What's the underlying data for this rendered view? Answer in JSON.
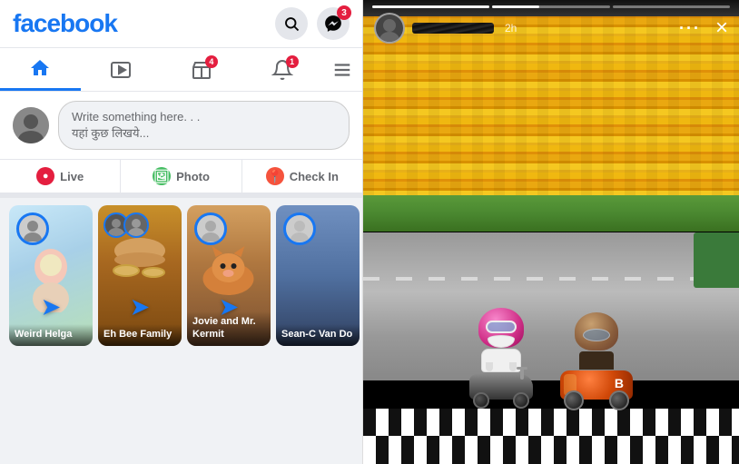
{
  "app": {
    "name": "facebook",
    "logo_color": "#1877f2"
  },
  "header": {
    "search_label": "Search",
    "messenger_label": "Messenger",
    "messenger_badge": "3"
  },
  "nav": {
    "tabs": [
      {
        "id": "home",
        "label": "Home",
        "icon": "🏠",
        "active": true,
        "badge": null
      },
      {
        "id": "watch",
        "label": "Watch",
        "icon": "▶",
        "active": false,
        "badge": null
      },
      {
        "id": "marketplace",
        "label": "Marketplace",
        "icon": "🛒",
        "active": false,
        "badge": "4"
      },
      {
        "id": "notifications",
        "label": "Notifications",
        "icon": "🔔",
        "active": false,
        "badge": "1"
      }
    ],
    "menu_icon": "☰"
  },
  "post_box": {
    "placeholder_line1": "Write something here. . .",
    "placeholder_line2": "यहां कुछ लिखये..."
  },
  "action_buttons": [
    {
      "id": "live",
      "label": "Live",
      "icon": "●"
    },
    {
      "id": "photo",
      "label": "Photo",
      "icon": "🖼"
    },
    {
      "id": "checkin",
      "label": "Check In",
      "icon": "📍"
    }
  ],
  "stories": [
    {
      "id": 1,
      "label": "Weird Helga",
      "bg": "story1",
      "has_arrow": true
    },
    {
      "id": 2,
      "label": "Eh Bee Family",
      "bg": "story2",
      "has_arrow": true
    },
    {
      "id": 3,
      "label": "Jovie and Mr. Kermit",
      "bg": "story3",
      "has_arrow": true
    },
    {
      "id": 4,
      "label": "Sean-C Van Do",
      "bg": "story4",
      "has_arrow": false
    }
  ],
  "right_story": {
    "username_hidden": true,
    "time": "2h",
    "progress_bars": [
      1,
      2,
      3
    ],
    "progress_fill_percent": 40,
    "scene": "go_kart_race",
    "characters": [
      {
        "id": "left",
        "helmet": "pink_with_goggles",
        "vehicle": "motorbike",
        "color": "white_panda"
      },
      {
        "id": "right",
        "helmet": "brown",
        "vehicle": "kart",
        "color": "dark",
        "number": "B"
      }
    ]
  }
}
